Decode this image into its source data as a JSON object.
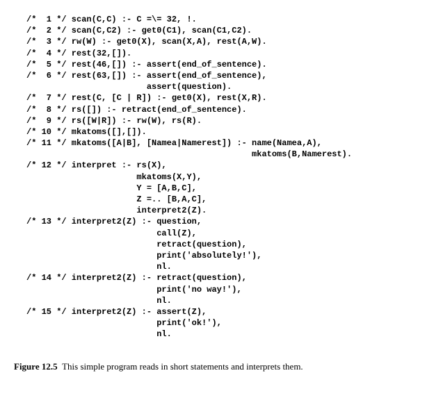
{
  "code": {
    "c1": "/*  1 */ scan(C,C) :- C =\\= 32, !.",
    "c2": "/*  2 */ scan(C,C2) :- get0(C1), scan(C1,C2).",
    "c3": "/*  3 */ rw(W) :- get0(X), scan(X,A), rest(A,W).",
    "c4": "/*  4 */ rest(32,[]).",
    "c5": "/*  5 */ rest(46,[]) :- assert(end_of_sentence).",
    "c6": "/*  6 */ rest(63,[]) :- assert(end_of_sentence),",
    "c6b": "                        assert(question).",
    "c7": "/*  7 */ rest(C, [C | R]) :- get0(X), rest(X,R).",
    "c8": "/*  8 */ rs([]) :- retract(end_of_sentence).",
    "c9": "/*  9 */ rs([W|R]) :- rw(W), rs(R).",
    "c10": "/* 10 */ mkatoms([],[]).",
    "c11": "/* 11 */ mkatoms([A|B], [Namea|Namerest]) :- name(Namea,A),",
    "c11b": "                                             mkatoms(B,Namerest).",
    "c12": "/* 12 */ interpret :- rs(X),",
    "c12b": "                      mkatoms(X,Y),",
    "c12c": "                      Y = [A,B,C],",
    "c12d": "                      Z =.. [B,A,C],",
    "c12e": "                      interpret2(Z).",
    "c13": "/* 13 */ interpret2(Z) :- question,",
    "c13b": "                          call(Z),",
    "c13c": "                          retract(question),",
    "c13d": "                          print('absolutely!'),",
    "c13e": "                          nl.",
    "c14": "/* 14 */ interpret2(Z) :- retract(question),",
    "c14b": "                          print('no way!'),",
    "c14c": "                          nl.",
    "c15": "/* 15 */ interpret2(Z) :- assert(Z),",
    "c15b": "                          print('ok!'),",
    "c15c": "                          nl."
  },
  "caption": {
    "label": "Figure 12.5",
    "text": "This simple program reads in short statements and interprets them."
  }
}
